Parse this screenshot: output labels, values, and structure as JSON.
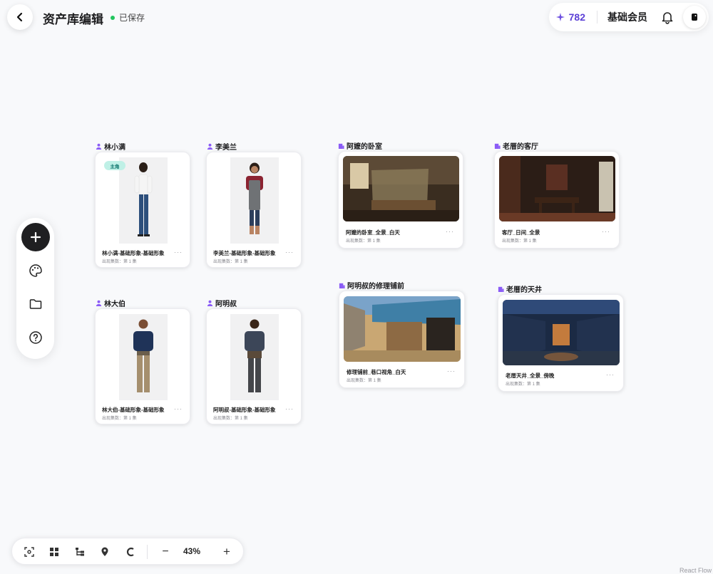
{
  "header": {
    "title": "资产库编辑",
    "save_status": "已保存"
  },
  "account": {
    "credits": "782",
    "membership": "基础会员"
  },
  "characters": [
    {
      "group": "林小满",
      "title": "林小满-基础形象-基础形象",
      "meta": "出现集数：第 1 集",
      "badge": "主角"
    },
    {
      "group": "李美兰",
      "title": "李美兰-基础形象-基础形象",
      "meta": "出现集数：第 1 集"
    },
    {
      "group": "林大伯",
      "title": "林大伯-基础形象-基础形象",
      "meta": "出现集数：第 1 集"
    },
    {
      "group": "阿明叔",
      "title": "阿明叔-基础形象-基础形象",
      "meta": "出现集数：第 1 集"
    }
  ],
  "scenes": [
    {
      "group": "阿嬷的卧室",
      "title": "阿嬷的卧室_全景_白天",
      "meta": "出现集数：第 1 集"
    },
    {
      "group": "老厝的客厅",
      "title": "客厅_日间_全景",
      "meta": "出现集数：第 1 集"
    },
    {
      "group": "阿明叔的修理铺前",
      "title": "修理铺前_巷口视角_白天",
      "meta": "出现集数：第 1 集"
    },
    {
      "group": "老厝的天井",
      "title": "老厝天井_全景_傍晚",
      "meta": "出现集数：第 1 集"
    }
  ],
  "more_label": "···",
  "zoom": "43%",
  "zoom_out_label": "−",
  "zoom_in_label": "+",
  "attribution": "React Flow",
  "colors": {
    "accent_purple": "#5b3fd6",
    "saved_green": "#22c55e",
    "badge_bg": "#bff0e6"
  },
  "icons": [
    "back-arrow-icon",
    "sparkle-icon",
    "bell-icon",
    "avatar-icon",
    "plus-icon",
    "palette-icon",
    "folder-icon",
    "help-icon",
    "person-icon",
    "place-icon",
    "fit-view-icon",
    "grid-layout-icon",
    "tree-layout-icon",
    "location-pin-icon",
    "magnet-icon"
  ]
}
